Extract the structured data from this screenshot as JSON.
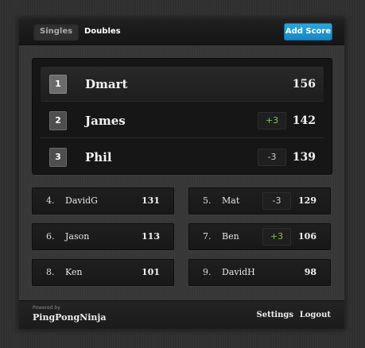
{
  "nav": {
    "tabs": [
      {
        "label": "Singles"
      },
      {
        "label": "Doubles"
      }
    ],
    "add_score_label": "Add Score"
  },
  "podium": [
    {
      "rank": "1",
      "name": "Dmart",
      "score": "156",
      "delta": ""
    },
    {
      "rank": "2",
      "name": "James",
      "score": "142",
      "delta": "+3"
    },
    {
      "rank": "3",
      "name": "Phil",
      "score": "139",
      "delta": "-3"
    }
  ],
  "rankings": [
    {
      "rank": "4.",
      "name": "DavidG",
      "score": "131",
      "delta": ""
    },
    {
      "rank": "5.",
      "name": "Mat",
      "score": "129",
      "delta": "-3"
    },
    {
      "rank": "6.",
      "name": "Jason",
      "score": "113",
      "delta": ""
    },
    {
      "rank": "7.",
      "name": "Ben",
      "score": "106",
      "delta": "+3"
    },
    {
      "rank": "8.",
      "name": "Ken",
      "score": "101",
      "delta": ""
    },
    {
      "rank": "9.",
      "name": "DavidH",
      "score": "98",
      "delta": ""
    }
  ],
  "footer": {
    "powered_by": "Powered by",
    "brand": "PingPongNinja",
    "settings_label": "Settings",
    "logout_label": "Logout"
  },
  "colors": {
    "accent": "#1f97d4",
    "positive": "#7fc24a",
    "background": "#2f2f2f"
  }
}
